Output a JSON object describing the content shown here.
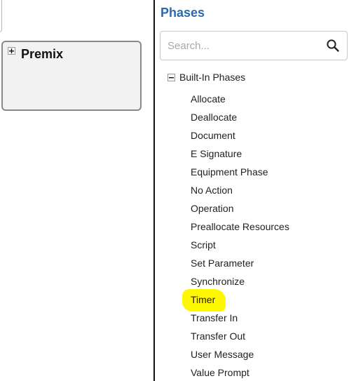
{
  "left_pane": {
    "node": {
      "title": "Premix"
    }
  },
  "phases_panel": {
    "title": "Phases",
    "search": {
      "placeholder": "Search...",
      "value": ""
    },
    "group": {
      "label": "Built-In Phases",
      "expanded": true,
      "items": [
        {
          "label": "Allocate"
        },
        {
          "label": "Deallocate"
        },
        {
          "label": "Document"
        },
        {
          "label": "E Signature"
        },
        {
          "label": "Equipment Phase"
        },
        {
          "label": "No Action"
        },
        {
          "label": "Operation"
        },
        {
          "label": "Preallocate Resources"
        },
        {
          "label": "Script"
        },
        {
          "label": "Set Parameter"
        },
        {
          "label": "Synchronize"
        },
        {
          "label": "Timer",
          "highlighted": true
        },
        {
          "label": "Transfer In"
        },
        {
          "label": "Transfer Out"
        },
        {
          "label": "User Message"
        },
        {
          "label": "Value Prompt"
        }
      ]
    }
  },
  "colors": {
    "title": "#2e6aa6",
    "highlight": "#fff700",
    "divider": "#111111"
  }
}
